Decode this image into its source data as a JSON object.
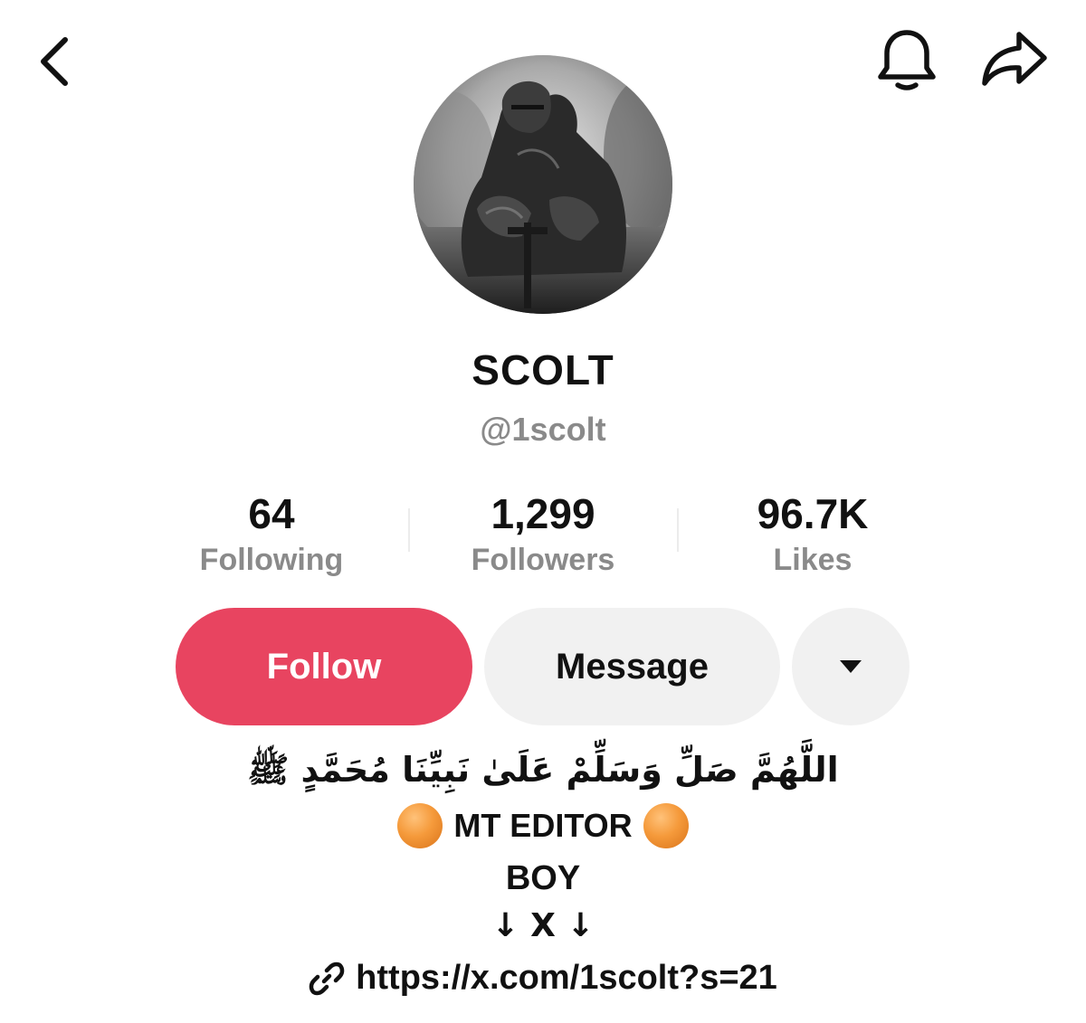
{
  "profile": {
    "display_name": "SCOLT",
    "handle": "@1scolt"
  },
  "stats": [
    {
      "value": "64",
      "label": "Following"
    },
    {
      "value": "1,299",
      "label": "Followers"
    },
    {
      "value": "96.7K",
      "label": "Likes"
    }
  ],
  "actions": {
    "follow_label": "Follow",
    "message_label": "Message"
  },
  "bio": {
    "arabic_line": "اللَّهُمَّ صَلِّ وَسَلِّمْ عَلَىٰ نَبِيِّنَا مُحَمَّدٍ ﷺ",
    "editor_line": "MT EDITOR",
    "boy_line": "BOY",
    "arrows_line": "↓ X ↓",
    "link": "https://x.com/1scolt?s=21"
  },
  "colors": {
    "follow_button": "#e84460",
    "secondary_button": "#f1f1f1",
    "muted_text": "#8a8a8a",
    "emoji_orange": "#f59a3b"
  },
  "icons": {
    "back": "chevron-left-icon",
    "notifications": "bell-icon",
    "share": "share-arrow-icon",
    "more": "caret-down-icon",
    "link": "link-icon",
    "emoji": "orange-circle-icon"
  }
}
